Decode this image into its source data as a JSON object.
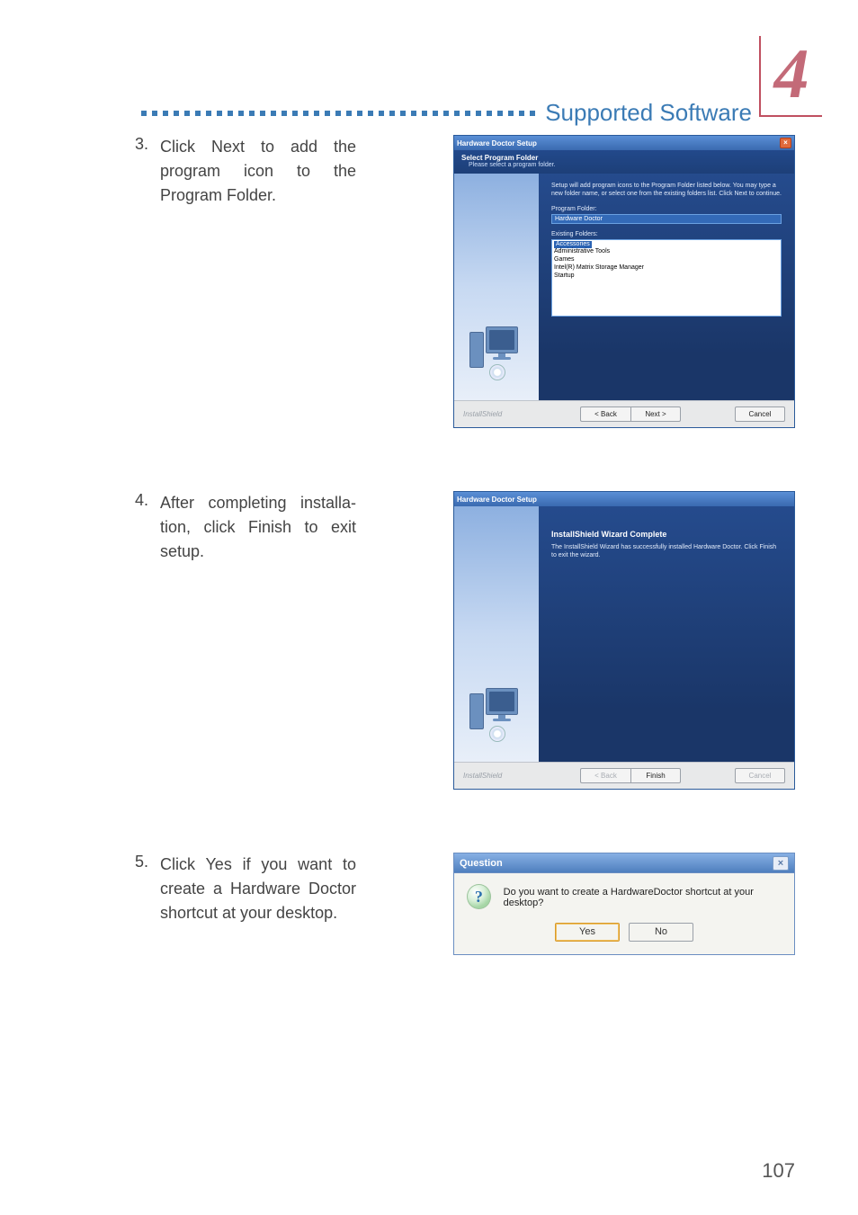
{
  "chapter": {
    "num": "4",
    "title": "Supported Software"
  },
  "page_number": "107",
  "steps": [
    {
      "num": "3.",
      "text": "Click Next to add the program icon to the Program Folder."
    },
    {
      "num": "4.",
      "text": "After completing installa­tion, click Finish to exit setup."
    },
    {
      "num": "5.",
      "text": "Click Yes if you want to create a Hardware Doctor shortcut at your desktop."
    }
  ],
  "wiz1": {
    "title": "Hardware Doctor Setup",
    "subhead_title": "Select Program Folder",
    "subhead_desc": "Please select a program folder.",
    "intro": "Setup will add program icons to the Program Folder listed below. You may type a new folder name, or select one from the existing folders list. Click Next to continue.",
    "label_program_folder": "Program Folder:",
    "program_folder_value": "Hardware Doctor",
    "label_existing": "Existing Folders:",
    "existing_folders": [
      "Accessories",
      "Administrative Tools",
      "Games",
      "Intel(R) Matrix Storage Manager",
      "Startup"
    ],
    "brand": "InstallShield",
    "btn_back": "< Back",
    "btn_next": "Next >",
    "btn_cancel": "Cancel"
  },
  "wiz2": {
    "title": "Hardware Doctor Setup",
    "complete_title": "InstallShield Wizard Complete",
    "complete_text": "The InstallShield Wizard has successfully installed Hardware Doctor. Click Finish to exit the wizard.",
    "brand": "InstallShield",
    "btn_back": "< Back",
    "btn_finish": "Finish",
    "btn_cancel": "Cancel"
  },
  "msgbox": {
    "title": "Question",
    "text": "Do you want to create a HardwareDoctor shortcut at your desktop?",
    "btn_yes": "Yes",
    "btn_no": "No"
  }
}
